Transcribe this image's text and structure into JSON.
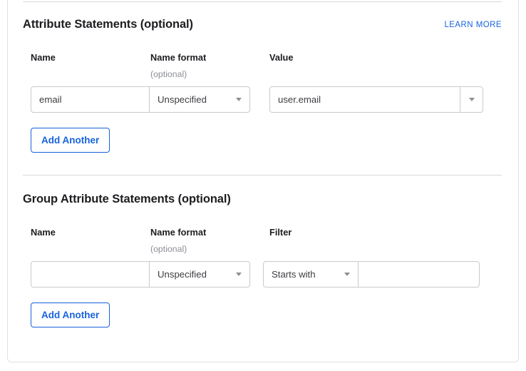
{
  "card": {
    "sections": [
      {
        "id": "attribute-statements",
        "title": "Attribute Statements (optional)",
        "learn_more": "LEARN MORE",
        "columns": [
          {
            "label": "Name",
            "sub": ""
          },
          {
            "label": "Name format",
            "sub": "(optional)"
          },
          {
            "label": "Value",
            "sub": ""
          }
        ],
        "row": {
          "name_value": "email",
          "name_placeholder": "",
          "format_value": "Unspecified",
          "value_value": "user.email",
          "value_placeholder": ""
        },
        "add_button": "Add Another"
      },
      {
        "id": "group-attribute-statements",
        "title": "Group Attribute Statements (optional)",
        "learn_more": "",
        "columns": [
          {
            "label": "Name",
            "sub": ""
          },
          {
            "label": "Name format",
            "sub": "(optional)"
          },
          {
            "label": "Filter",
            "sub": ""
          }
        ],
        "row": {
          "name_value": "",
          "name_placeholder": "",
          "format_value": "Unspecified",
          "filter_value": "Starts with",
          "filter_text_value": "",
          "filter_text_placeholder": ""
        },
        "add_button": "Add Another"
      }
    ]
  },
  "icons": {
    "caret_down": "chevron-down-icon"
  },
  "colors": {
    "accent": "#1662dd",
    "text": "#1d1d21",
    "muted": "#8c8f96",
    "border": "#c8cacf",
    "divider": "#d9dade",
    "card_border": "#dfe1e6"
  }
}
